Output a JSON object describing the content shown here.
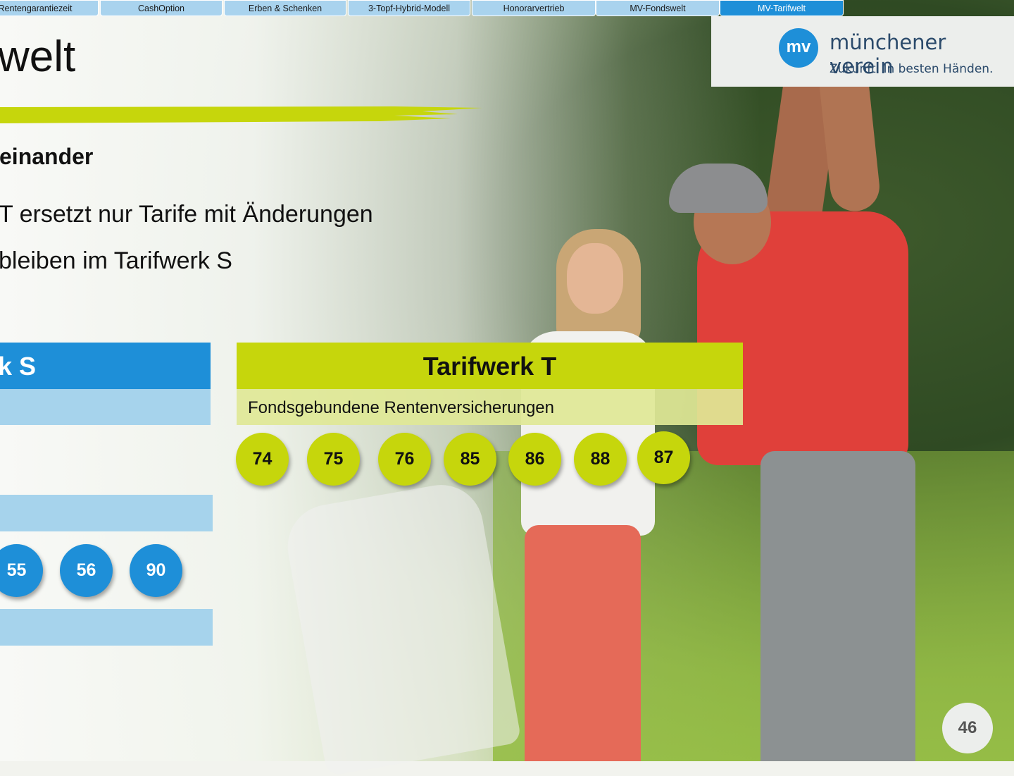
{
  "nav": {
    "tabs": [
      {
        "label": "Rentengarantiezeit",
        "active": false
      },
      {
        "label": "CashOption",
        "active": false
      },
      {
        "label": "Erben & Schenken",
        "active": false
      },
      {
        "label": "3-Topf-Hybrid-Modell",
        "active": false
      },
      {
        "label": "Honorarvertrieb",
        "active": false
      },
      {
        "label": "MV-Fondswelt",
        "active": false
      },
      {
        "label": "MV-Tarifwelt",
        "active": true
      }
    ]
  },
  "logo": {
    "mark": "mv",
    "name": "münchener verein",
    "tagline": "Zukunft. In besten Händen."
  },
  "slide": {
    "title": "welt",
    "subheading": "einander",
    "bullets": [
      "T ersetzt nur Tarife mit Änderungen",
      "bleiben im Tarifwerk S"
    ],
    "page_number": "46"
  },
  "tarifwerk_s": {
    "title": "k S",
    "circles": [
      "55",
      "56",
      "90"
    ]
  },
  "tarifwerk_t": {
    "title": "Tarifwerk T",
    "subtitle": "Fondsgebundene Rentenversicherungen",
    "circles": [
      "74",
      "75",
      "76",
      "85",
      "86",
      "88",
      "87"
    ]
  },
  "colors": {
    "blue": "#1e8fd8",
    "light_blue": "#a6d3ec",
    "lime": "#c6d60c",
    "light_lime": "#dfe896"
  }
}
